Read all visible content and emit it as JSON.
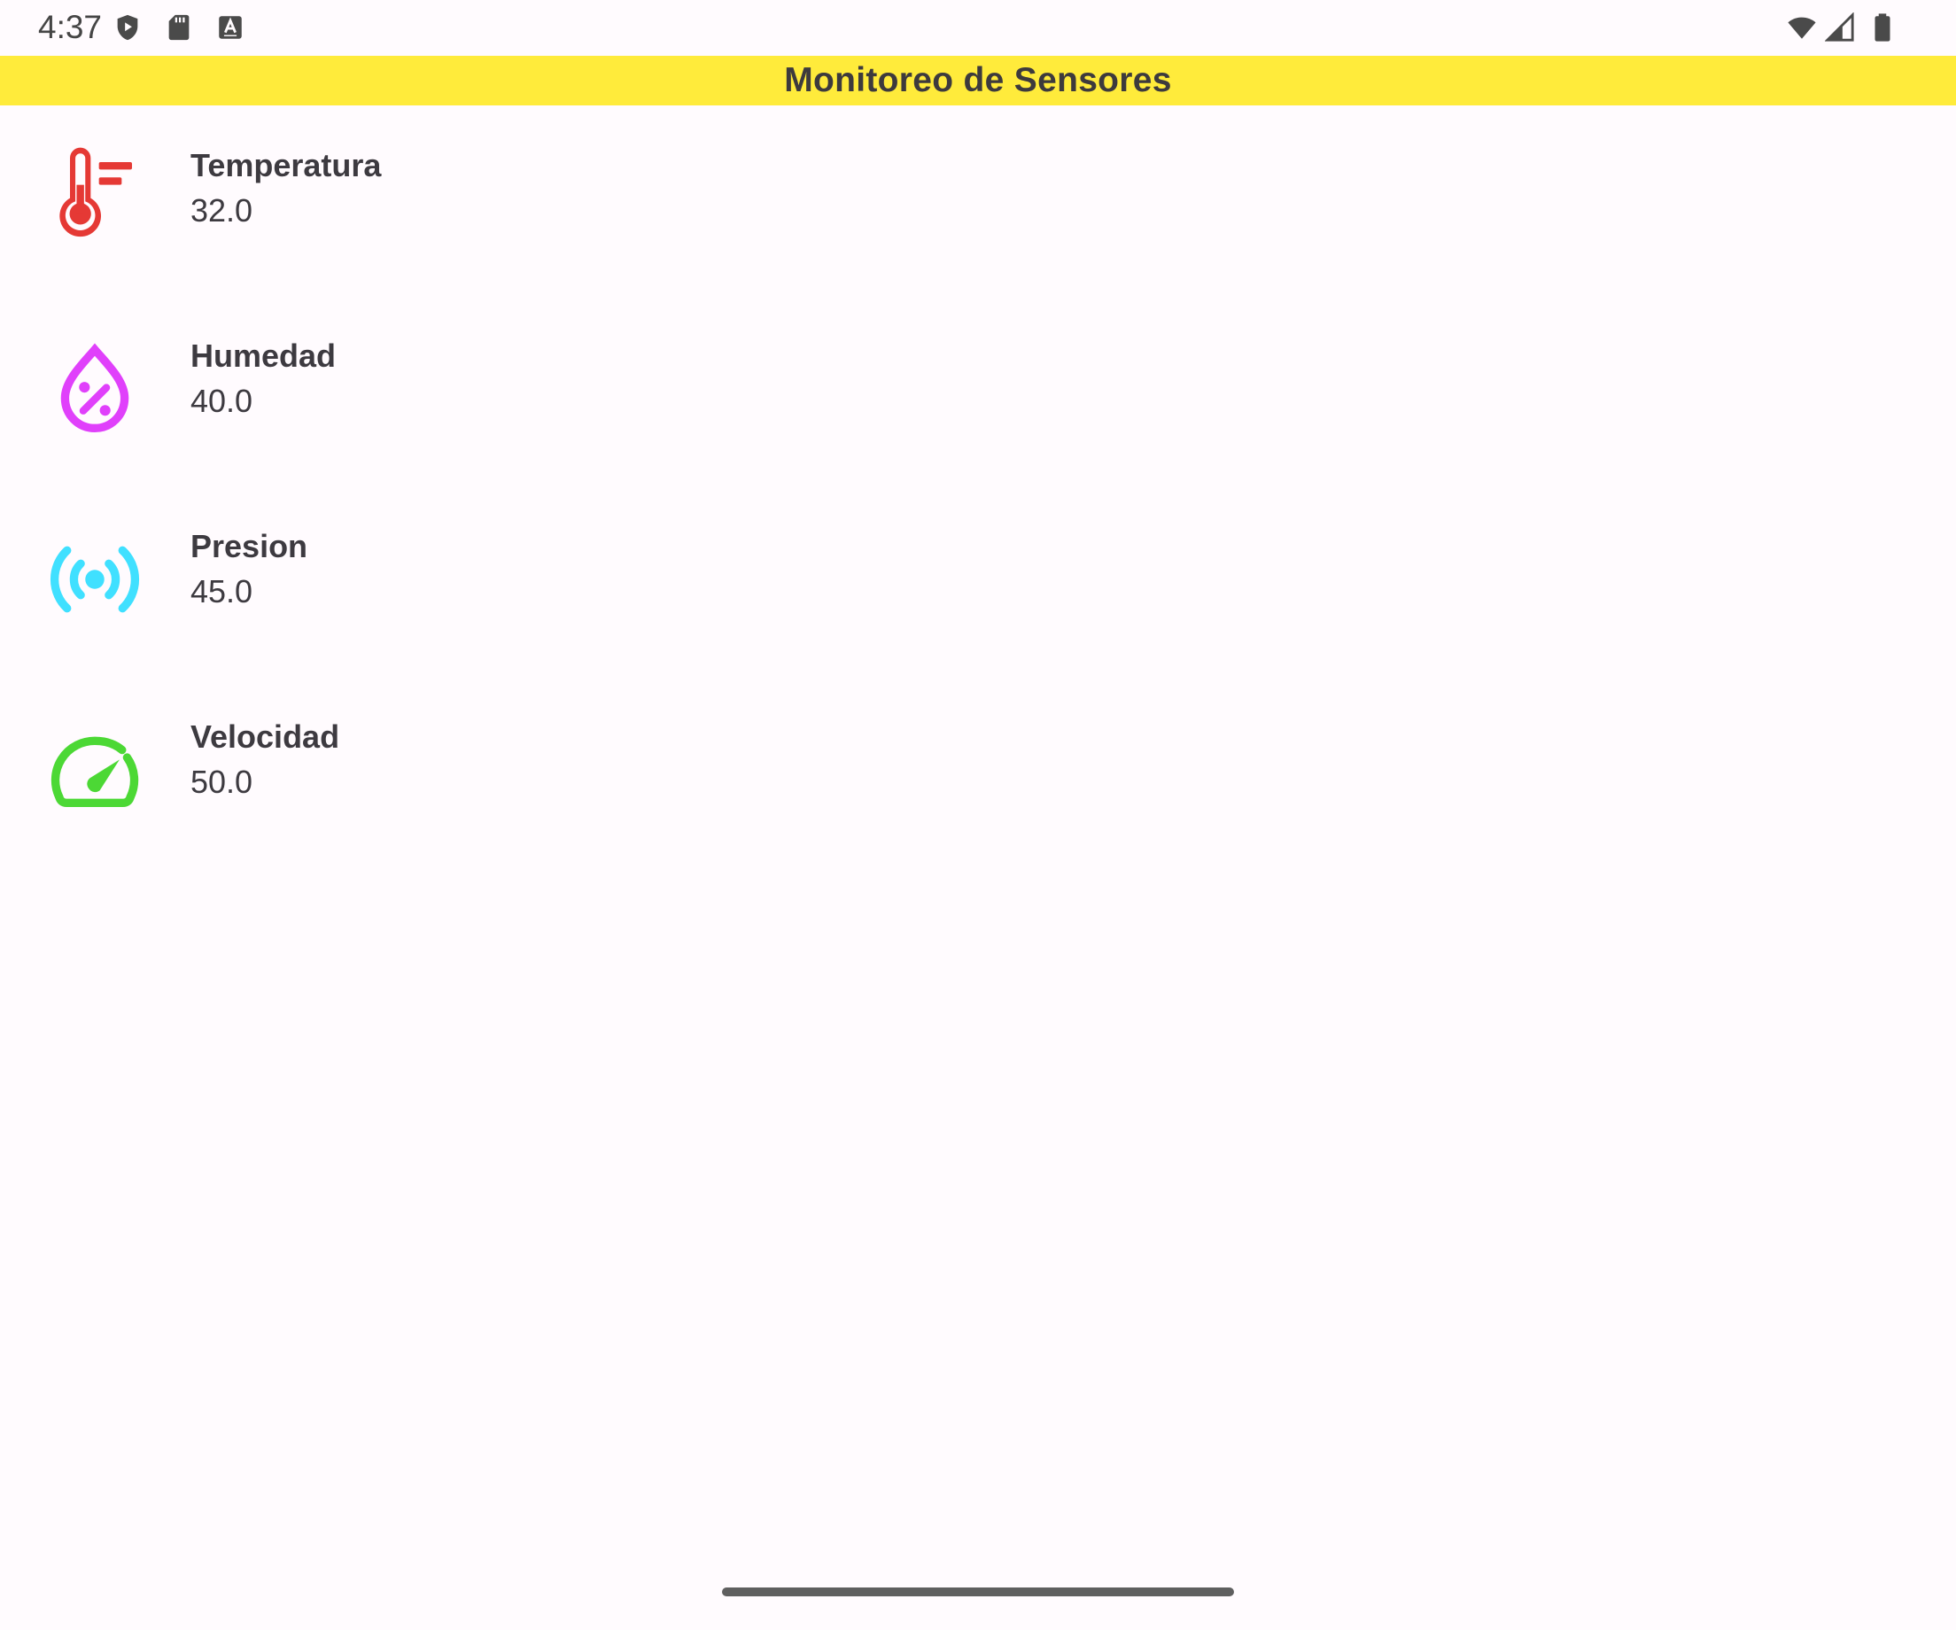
{
  "status_bar": {
    "time": "4:37",
    "icons_left": [
      "play-protect-icon",
      "sd-card-icon",
      "keyboard-a-icon"
    ],
    "icons_right": [
      "wifi-icon",
      "cell-signal-icon",
      "battery-icon"
    ]
  },
  "app_bar": {
    "title": "Monitoreo de Sensores",
    "background": "#ffeb3b"
  },
  "sensors": [
    {
      "name": "Temperatura",
      "value": "32.0",
      "icon": "thermometer-icon",
      "color": "#e53935"
    },
    {
      "name": "Humedad",
      "value": "40.0",
      "icon": "humidity-percent-icon",
      "color": "#e040fb"
    },
    {
      "name": "Presion",
      "value": "45.0",
      "icon": "sensors-icon",
      "color": "#40e0ff"
    },
    {
      "name": "Velocidad",
      "value": "50.0",
      "icon": "speed-icon",
      "color": "#4cd835"
    }
  ]
}
